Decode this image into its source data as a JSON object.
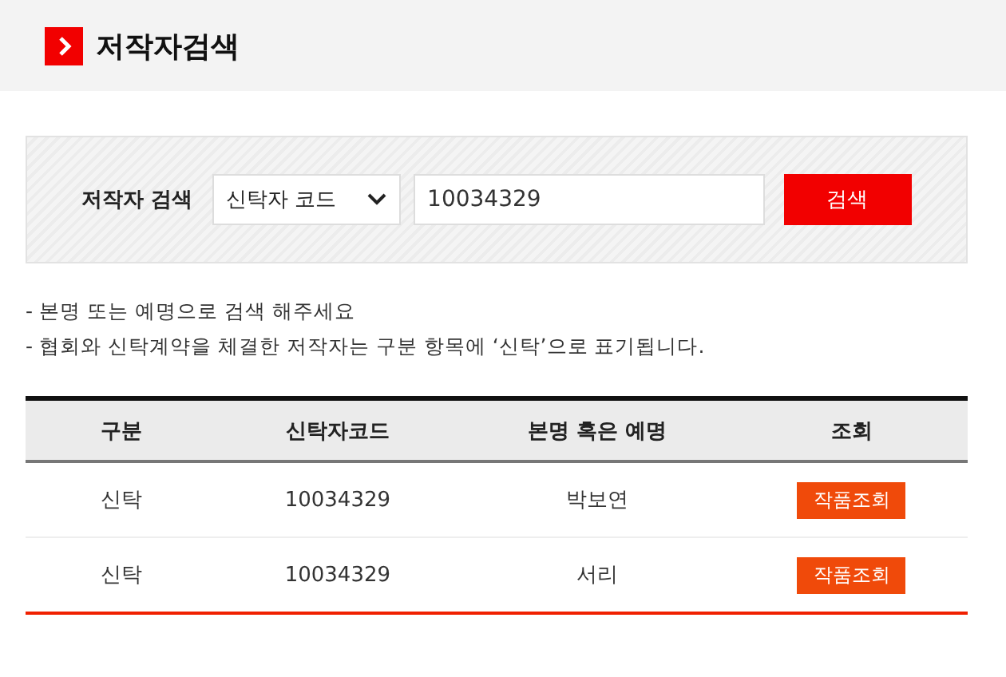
{
  "page_title": "저작자검색",
  "search": {
    "label": "저작자 검색",
    "select_value": "신탁자 코드",
    "query": "10034329",
    "button": "검색"
  },
  "notes": [
    "- 본명 또는 예명으로 검색 해주세요",
    "- 협회와 신탁계약을 체결한 저작자는 구분 항목에 ‘신탁’으로 표기됩니다."
  ],
  "table": {
    "columns": [
      "구분",
      "신탁자코드",
      "본명 혹은 예명",
      "조회"
    ],
    "rows": [
      {
        "type": "신탁",
        "code": "10034329",
        "name": "박보연",
        "action": "작품조회"
      },
      {
        "type": "신탁",
        "code": "10034329",
        "name": "서리",
        "action": "작품조회"
      }
    ]
  }
}
